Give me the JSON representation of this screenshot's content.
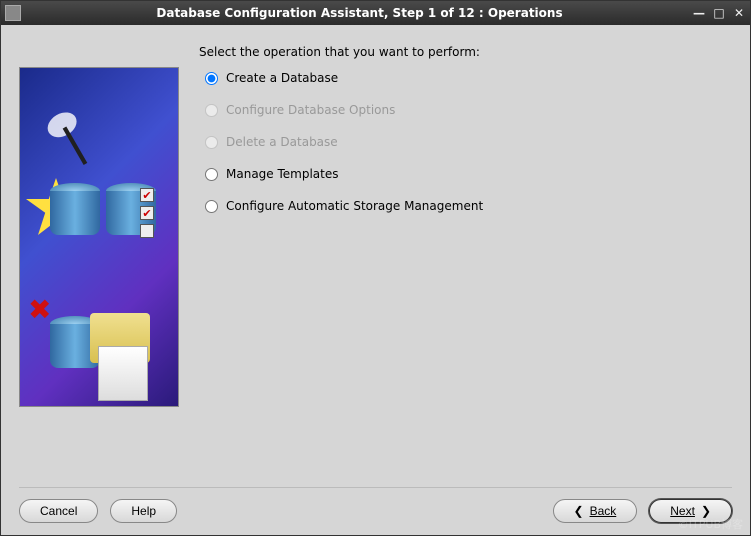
{
  "titlebar": {
    "title": "Database Configuration Assistant, Step 1 of 12 : Operations"
  },
  "prompt": "Select the operation that you want to perform:",
  "options": {
    "create": {
      "label": "Create a Database",
      "selected": true,
      "enabled": true
    },
    "configure": {
      "label": "Configure Database Options",
      "selected": false,
      "enabled": false
    },
    "delete": {
      "label": "Delete a Database",
      "selected": false,
      "enabled": false
    },
    "templates": {
      "label": "Manage Templates",
      "selected": false,
      "enabled": true
    },
    "asm": {
      "label": "Configure Automatic Storage Management",
      "selected": false,
      "enabled": true
    }
  },
  "buttons": {
    "cancel": "Cancel",
    "help": "Help",
    "back": "Back",
    "next": "Next"
  },
  "watermark": "©ITPUB博客"
}
